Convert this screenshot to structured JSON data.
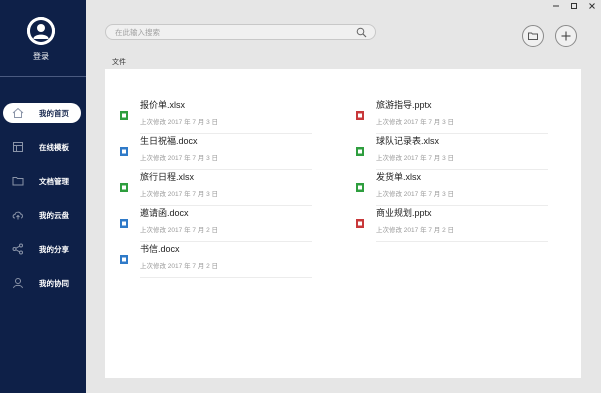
{
  "user": {
    "login_label": "登录"
  },
  "nav": [
    {
      "id": "home",
      "label": "我的首页",
      "icon": "home-icon",
      "active": true
    },
    {
      "id": "templates",
      "label": "在线模板",
      "icon": "template-icon",
      "active": false
    },
    {
      "id": "docs",
      "label": "文档管理",
      "icon": "folder-icon",
      "active": false
    },
    {
      "id": "cloud",
      "label": "我的云盘",
      "icon": "cloud-upload-icon",
      "active": false
    },
    {
      "id": "share",
      "label": "我的分享",
      "icon": "share-icon",
      "active": false
    },
    {
      "id": "collab",
      "label": "我的协同",
      "icon": "user-icon",
      "active": false
    }
  ],
  "search": {
    "placeholder": "在此输入搜索"
  },
  "panel": {
    "title": "文件"
  },
  "files_left": [
    {
      "name": "报价单.xlsx",
      "meta": "上次修改 2017 年 7 月 3 日",
      "type": "xlsx"
    },
    {
      "name": "生日祝福.docx",
      "meta": "上次修改 2017 年 7 月 3 日",
      "type": "docx"
    },
    {
      "name": "旅行日程.xlsx",
      "meta": "上次修改 2017 年 7 月 3 日",
      "type": "xlsx"
    },
    {
      "name": "邀请函.docx",
      "meta": "上次修改 2017 年 7 月 2 日",
      "type": "docx"
    },
    {
      "name": "书信.docx",
      "meta": "上次修改 2017 年 7 月 2 日",
      "type": "docx"
    }
  ],
  "files_right": [
    {
      "name": "旅游指导.pptx",
      "meta": "上次修改 2017 年 7 月 3 日",
      "type": "pptx"
    },
    {
      "name": "球队记录表.xlsx",
      "meta": "上次修改 2017 年 7 月 3 日",
      "type": "xlsx"
    },
    {
      "name": "发货单.xlsx",
      "meta": "上次修改 2017 年 7 月 3 日",
      "type": "xlsx"
    },
    {
      "name": "商业规划.pptx",
      "meta": "上次修改 2017 年 7 月 2 日",
      "type": "pptx"
    }
  ],
  "colors": {
    "sidebar_bg": "#0e2048",
    "xlsx": "#2e9e3e",
    "docx": "#2f7ac8",
    "pptx": "#c8383a"
  }
}
